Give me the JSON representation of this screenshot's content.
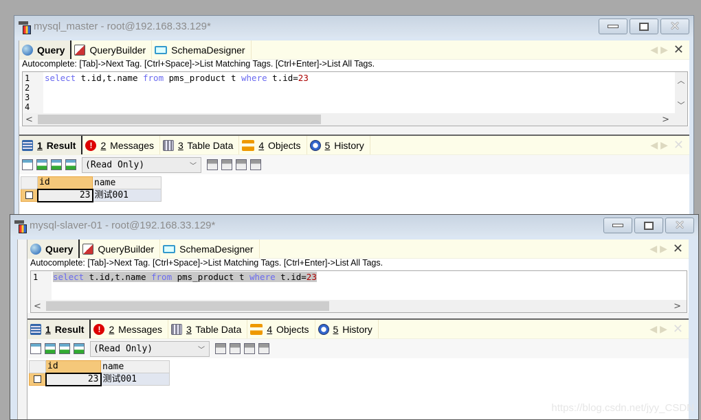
{
  "windows": [
    {
      "title": "mysql_master - root@192.168.33.129*",
      "editor_tabs": [
        "Query",
        "QueryBuilder",
        "SchemaDesigner"
      ],
      "autocomplete": "Autocomplete: [Tab]->Next Tag. [Ctrl+Space]->List Matching Tags. [Ctrl+Enter]->List All Tags.",
      "line_numbers": "1\n2\n3\n4",
      "sql": {
        "kw1": "select",
        "t1": " t.id,t.name ",
        "kw2": "from",
        "t2": " pms_product t ",
        "kw3": "where",
        "t3": " t.id=",
        "num": "23"
      },
      "result_tabs": [
        {
          "num": "1",
          "label": "Result"
        },
        {
          "num": "2",
          "label": "Messages"
        },
        {
          "num": "3",
          "label": "Table Data"
        },
        {
          "num": "4",
          "label": "Objects"
        },
        {
          "num": "5",
          "label": "History"
        }
      ],
      "mode_select": "(Read Only)",
      "grid": {
        "columns": [
          "id",
          "name"
        ],
        "rows": [
          [
            "23",
            "测试001"
          ]
        ]
      }
    },
    {
      "title": "mysql-slaver-01 - root@192.168.33.129*",
      "editor_tabs": [
        "Query",
        "QueryBuilder",
        "SchemaDesigner"
      ],
      "autocomplete": "Autocomplete: [Tab]->Next Tag. [Ctrl+Space]->List Matching Tags. [Ctrl+Enter]->List All Tags.",
      "line_numbers": "1",
      "sql": {
        "kw1": "select",
        "t1": " t.id,t.name ",
        "kw2": "from",
        "t2": " pms_product t ",
        "kw3": "where",
        "t3": " t.id=",
        "num": "23"
      },
      "result_tabs": [
        {
          "num": "1",
          "label": "Result"
        },
        {
          "num": "2",
          "label": "Messages"
        },
        {
          "num": "3",
          "label": "Table Data"
        },
        {
          "num": "4",
          "label": "Objects"
        },
        {
          "num": "5",
          "label": "History"
        }
      ],
      "mode_select": "(Read Only)",
      "grid": {
        "columns": [
          "id",
          "name"
        ],
        "rows": [
          [
            "23",
            "测试001"
          ]
        ]
      }
    }
  ],
  "watermark": "https://blog.csdn.net/jyy_CSDN"
}
